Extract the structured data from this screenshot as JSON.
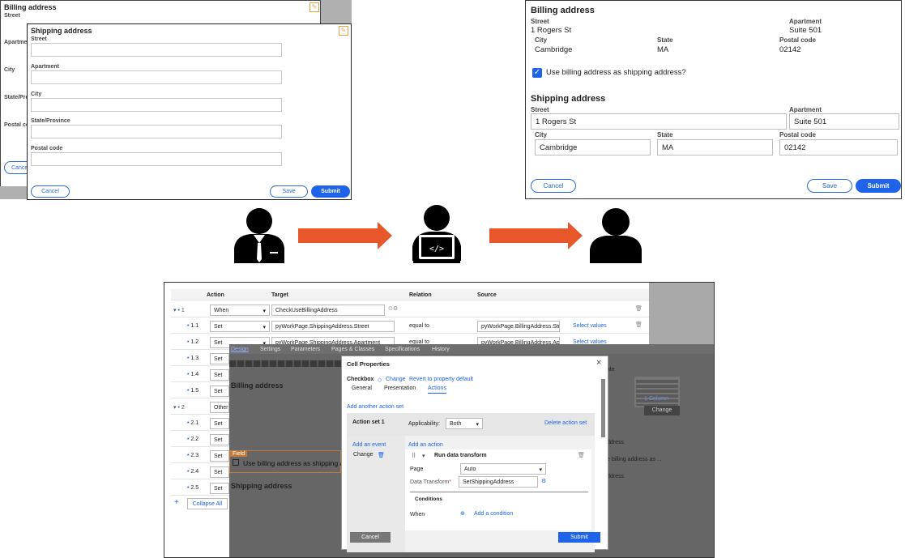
{
  "left_forms": {
    "back": {
      "title": "Billing address",
      "fields": [
        "Street",
        "Apartment",
        "City",
        "State/Province",
        "Postal code"
      ],
      "cancel": "Cancel"
    },
    "front": {
      "title": "Shipping address",
      "fields": [
        "Street",
        "Apartment",
        "City",
        "State/Province",
        "Postal code"
      ],
      "cancel": "Cancel",
      "save": "Save",
      "submit": "Submit"
    }
  },
  "right_form": {
    "billing_title": "Billing address",
    "billing": {
      "street_label": "Street",
      "street": "1 Rogers St",
      "apt_label": "Apartment",
      "apt": "Suite 501",
      "city_label": "City",
      "city": "Cambridge",
      "state_label": "State",
      "state": "MA",
      "postal_label": "Postal code",
      "postal": "02142"
    },
    "checkbox_label": "Use billing address as shipping address?",
    "shipping_title": "Shipping address",
    "shipping": {
      "street_label": "Street",
      "street": "1 Rogers St",
      "apt_label": "Apartment",
      "apt": "Suite 501",
      "city_label": "City",
      "city": "Cambridge",
      "state_label": "State",
      "state": "MA",
      "postal_label": "Postal code",
      "postal": "02142"
    },
    "cancel": "Cancel",
    "save": "Save",
    "submit": "Submit"
  },
  "flow": {
    "persons": [
      "business-person-icon",
      "developer-laptop-icon",
      "user-icon"
    ],
    "arrow_color": "#e8572a",
    "laptop_code": "</>"
  },
  "data_transform": {
    "headers": [
      "Action",
      "Target",
      "Relation",
      "Source"
    ],
    "rows": [
      {
        "num": "1",
        "action": "When",
        "target": "CheckUseBillingAddress",
        "relation": "",
        "source": ""
      },
      {
        "num": "1.1",
        "action": "Set",
        "target": "pyWorkPage.ShippingAddress.Street",
        "relation": "equal to",
        "source": "pyWorkPage.BillingAddress.Str",
        "extra": "Select values"
      },
      {
        "num": "1.2",
        "action": "Set",
        "target": "pyWorkPage.ShippingAddress.Apartment",
        "relation": "equal to",
        "source": "pyWorkPage.BillingAddress.Ap",
        "extra": "Select values"
      },
      {
        "num": "1.3",
        "action": "Set"
      },
      {
        "num": "1.4",
        "action": "Set"
      },
      {
        "num": "1.5",
        "action": "Set"
      },
      {
        "num": "2",
        "action": "Other"
      },
      {
        "num": "2.1",
        "action": "Set"
      },
      {
        "num": "2.2",
        "action": "Set"
      },
      {
        "num": "2.3",
        "action": "Set"
      },
      {
        "num": "2.4",
        "action": "Set"
      },
      {
        "num": "2.5",
        "action": "Set"
      }
    ],
    "collapse_all": "Collapse All"
  },
  "designer": {
    "tabs": [
      "Design",
      "Settings",
      "Parameters",
      "Pages & Classes",
      "Specifications",
      "History"
    ],
    "billing": "Billing address",
    "field_tag": "Field",
    "checkbox_text": "Use billing address as shipping ad",
    "shipping": "Shipping address",
    "right_col": {
      "columns": "1 Column",
      "change": "Change",
      "ate": "ate",
      "items": [
        "ddress",
        "e billing address as ...",
        "ddress"
      ]
    }
  },
  "cell_props": {
    "title": "Cell Properties",
    "control": "Checkbox",
    "change": "Change",
    "revert": "Revert to property default",
    "tabs": [
      "General",
      "Presentation",
      "Actions"
    ],
    "add_action_set": "Add another action set",
    "action_set": "Action set 1",
    "applicability_label": "Applicability:",
    "applicability": "Both",
    "delete_action_set": "Delete action set",
    "add_event": "Add an event",
    "event": "Change",
    "add_action": "Add an action",
    "action": "Run data transform",
    "page_label": "Page",
    "page": "Auto",
    "dt_label": "Data Transform",
    "dt_value": "SetShippingAddress",
    "conditions": "Conditions",
    "when": "When",
    "add_condition": "Add a condition",
    "cancel": "Cancel",
    "submit": "Submit"
  }
}
